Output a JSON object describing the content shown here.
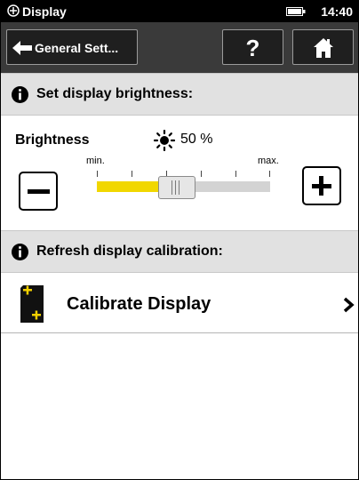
{
  "status_bar": {
    "title": "Display",
    "time": "14:40"
  },
  "nav": {
    "back_label": "General Sett...",
    "help_label": "?"
  },
  "brightness_section": {
    "header": "Set display brightness:",
    "label": "Brightness",
    "value_text": "50 %",
    "value": 50,
    "scale_min_label": "min.",
    "scale_max_label": "max."
  },
  "calibration_section": {
    "header": "Refresh display calibration:",
    "item_label": "Calibrate Display"
  },
  "colors": {
    "slider_fill": "#f1d700",
    "header_bg": "#e1e1e1",
    "nav_bg": "#3a3a3a"
  },
  "icons": [
    "app-icon",
    "battery-icon",
    "back-arrow-icon",
    "home-icon",
    "info-icon",
    "sun-icon",
    "minus-icon",
    "plus-icon",
    "calibrate-icon",
    "chevron-right-icon"
  ]
}
